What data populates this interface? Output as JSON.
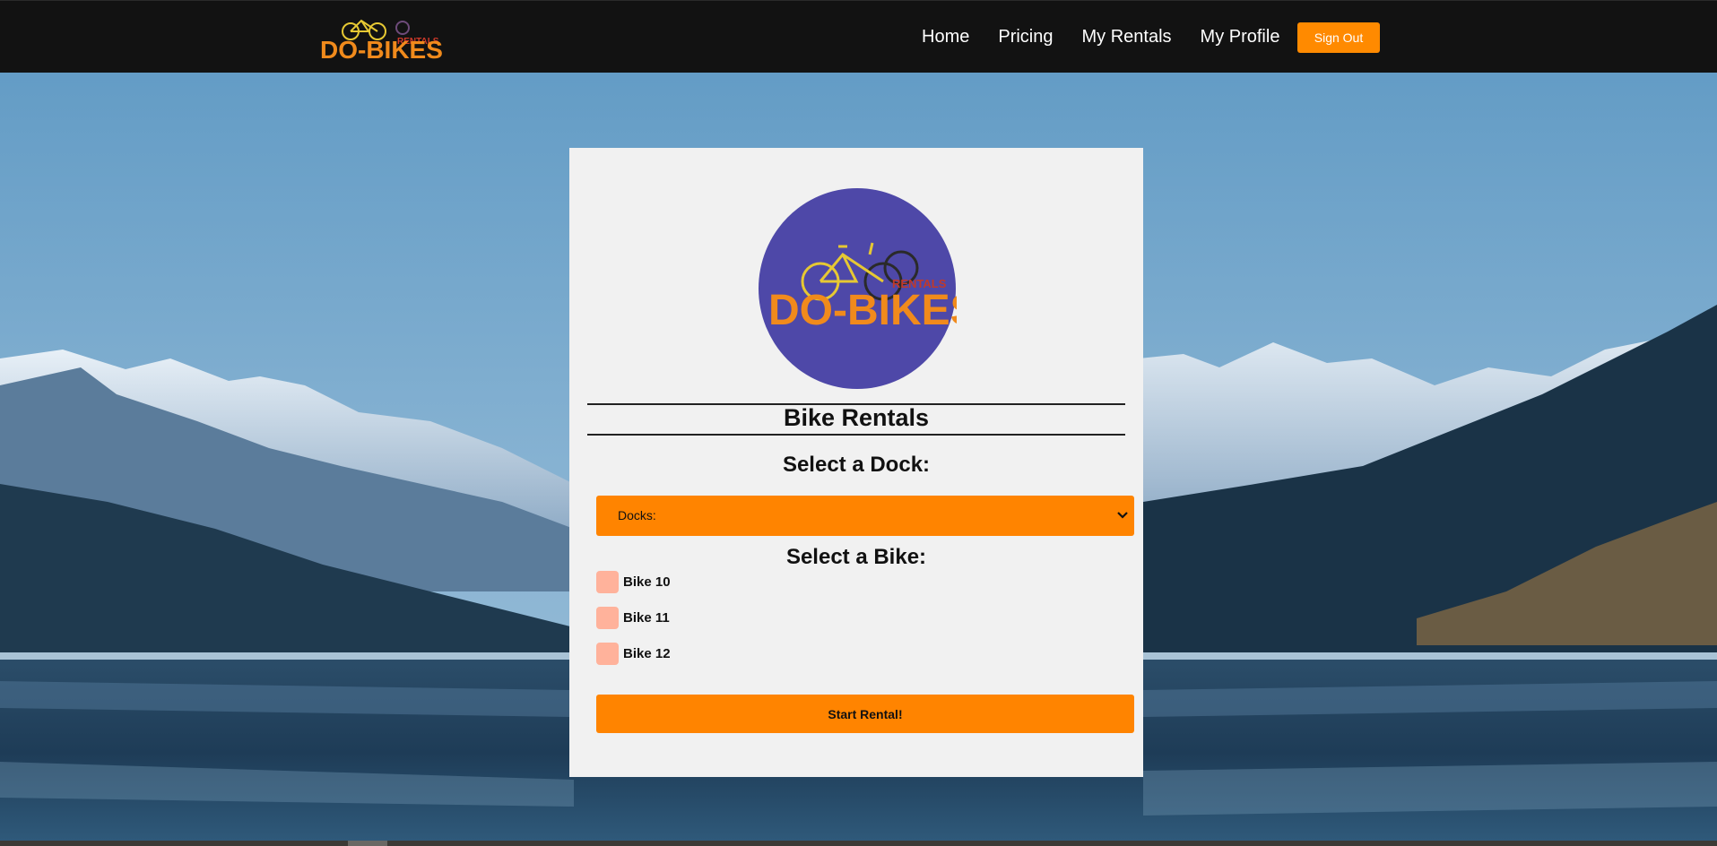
{
  "nav": {
    "brand_text": "DO-BIKES",
    "brand_sub": "RENTALS",
    "links": [
      {
        "label": "Home"
      },
      {
        "label": "Pricing"
      },
      {
        "label": "My Rentals"
      },
      {
        "label": "My Profile"
      }
    ],
    "signout_label": "Sign Out"
  },
  "card": {
    "logo_text": "DO-BIKES",
    "logo_sub": "RENTALS",
    "title": "Bike Rentals",
    "dock_heading": "Select a Dock:",
    "dock_select": {
      "selected": "Docks:"
    },
    "bike_heading": "Select a Bike:",
    "bikes": [
      {
        "label": "Bike 10"
      },
      {
        "label": "Bike 11"
      },
      {
        "label": "Bike 12"
      }
    ],
    "start_label": "Start Rental!"
  },
  "colors": {
    "accent": "#ff8400",
    "nav_bg": "#121212",
    "card_bg": "#f1f1f1",
    "checkbox": "#ffb29b",
    "logo_circle": "#4e48a8"
  },
  "icons": {
    "nav_logo": "bicycle-logo-icon",
    "card_logo": "bicycle-logo-icon",
    "select_arrow": "chevron-down-icon"
  }
}
